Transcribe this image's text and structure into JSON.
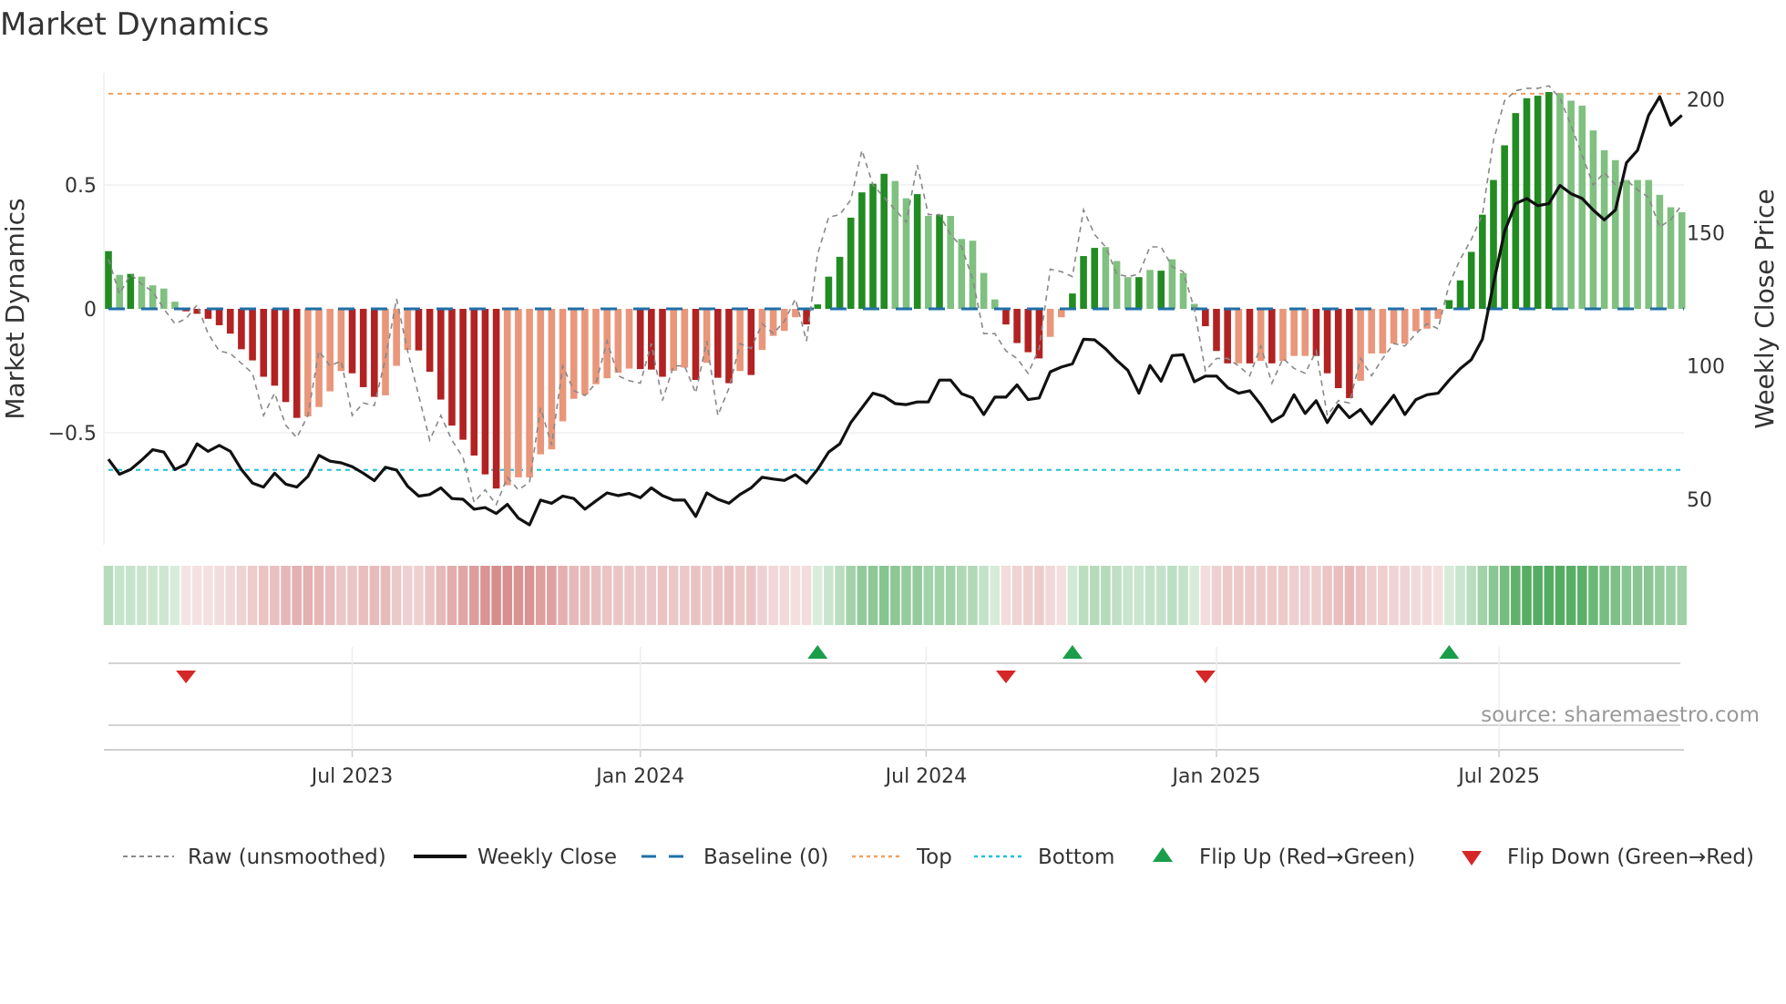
{
  "chart_data": {
    "type": "bar",
    "title": "Market Dynamics",
    "ylabel": "Market Dynamics",
    "y2label": "Weekly Close Price",
    "source": "source: sharemaestro.com",
    "ylim": [
      -0.98,
      0.96
    ],
    "y2lim": [
      35,
      210
    ],
    "yticks": [
      {
        "v": 0.5,
        "label": "0.5"
      },
      {
        "v": 0,
        "label": "0"
      },
      {
        "v": -0.5,
        "label": "−0.5"
      }
    ],
    "y2ticks": [
      {
        "v": 200,
        "label": "200"
      },
      {
        "v": 150,
        "label": "150"
      },
      {
        "v": 100,
        "label": "100"
      },
      {
        "v": 50,
        "label": "50"
      }
    ],
    "xticks": [
      {
        "i": 22,
        "label": "Jul 2023"
      },
      {
        "i": 48,
        "label": "Jan 2024"
      },
      {
        "i": 73.8,
        "label": "Jul 2024"
      },
      {
        "i": 100,
        "label": "Jan 2025"
      },
      {
        "i": 125.5,
        "label": "Jul 2025"
      }
    ],
    "top_level": 0.868,
    "bottom_level": -0.65,
    "baseline": 0,
    "colors": {
      "up_strong": "#228b22",
      "up_weak": "#80c080",
      "down_strong": "#b22222",
      "down_weak": "#e9967a",
      "close": "#111111",
      "raw": "#888888",
      "baseline": "#1f6fa8",
      "top": "#f0a060",
      "bottom": "#22c0d8",
      "flip_up": "#1a9e4a",
      "flip_down": "#d62728"
    },
    "smoothed": [
      0.233,
      0.137,
      0.141,
      0.13,
      0.095,
      0.082,
      0.029,
      -0.01,
      -0.02,
      -0.04,
      -0.066,
      -0.1,
      -0.163,
      -0.208,
      -0.274,
      -0.31,
      -0.376,
      -0.44,
      -0.434,
      -0.396,
      -0.333,
      -0.251,
      -0.26,
      -0.316,
      -0.355,
      -0.349,
      -0.23,
      -0.166,
      -0.168,
      -0.254,
      -0.366,
      -0.471,
      -0.528,
      -0.592,
      -0.668,
      -0.725,
      -0.712,
      -0.68,
      -0.68,
      -0.587,
      -0.567,
      -0.454,
      -0.363,
      -0.346,
      -0.304,
      -0.28,
      -0.258,
      -0.241,
      -0.243,
      -0.245,
      -0.274,
      -0.25,
      -0.237,
      -0.287,
      -0.218,
      -0.278,
      -0.3,
      -0.251,
      -0.267,
      -0.166,
      -0.109,
      -0.089,
      -0.034,
      -0.063,
      0.018,
      0.13,
      0.21,
      0.368,
      0.47,
      0.505,
      0.545,
      0.516,
      0.446,
      0.463,
      0.375,
      0.38,
      0.375,
      0.282,
      0.275,
      0.145,
      0.038,
      -0.063,
      -0.138,
      -0.175,
      -0.2,
      -0.113,
      -0.034,
      0.062,
      0.213,
      0.246,
      0.249,
      0.193,
      0.128,
      0.128,
      0.157,
      0.154,
      0.2,
      0.145,
      0.02,
      -0.07,
      -0.17,
      -0.22,
      -0.22,
      -0.22,
      -0.21,
      -0.22,
      -0.21,
      -0.19,
      -0.19,
      -0.19,
      -0.26,
      -0.32,
      -0.36,
      -0.29,
      -0.18,
      -0.18,
      -0.14,
      -0.14,
      -0.09,
      -0.08,
      -0.04,
      0.035,
      0.115,
      0.23,
      0.38,
      0.52,
      0.66,
      0.79,
      0.85,
      0.86,
      0.875,
      0.87,
      0.84,
      0.82,
      0.72,
      0.64,
      0.6,
      0.52,
      0.52,
      0.52,
      0.46,
      0.41,
      0.39
    ],
    "strong": [
      1,
      0,
      1,
      0,
      0,
      0,
      0,
      1,
      1,
      1,
      1,
      1,
      1,
      1,
      1,
      1,
      1,
      1,
      0,
      0,
      0,
      0,
      1,
      1,
      1,
      0,
      0,
      0,
      1,
      1,
      1,
      1,
      1,
      1,
      1,
      1,
      0,
      0,
      0,
      0,
      0,
      0,
      0,
      0,
      0,
      0,
      0,
      0,
      1,
      1,
      1,
      0,
      0,
      1,
      0,
      1,
      1,
      0,
      1,
      0,
      0,
      0,
      0,
      1,
      1,
      1,
      1,
      1,
      1,
      1,
      1,
      0,
      0,
      1,
      0,
      1,
      0,
      0,
      0,
      0,
      0,
      1,
      1,
      1,
      1,
      0,
      0,
      1,
      1,
      1,
      0,
      0,
      0,
      1,
      0,
      1,
      0,
      0,
      0,
      1,
      1,
      1,
      0,
      1,
      0,
      1,
      0,
      0,
      0,
      1,
      1,
      1,
      1,
      0,
      0,
      0,
      0,
      0,
      0,
      0,
      0,
      1,
      1,
      1,
      1,
      1,
      1,
      1,
      1,
      1,
      1,
      0,
      0,
      0,
      0,
      0,
      0,
      0,
      0,
      0,
      0,
      0,
      0
    ],
    "raw": [
      0.2,
      0.06,
      0.14,
      0.1,
      0.07,
      0.0,
      -0.06,
      -0.04,
      0.016,
      -0.1,
      -0.17,
      -0.18,
      -0.22,
      -0.26,
      -0.43,
      -0.34,
      -0.47,
      -0.52,
      -0.43,
      -0.17,
      -0.23,
      -0.21,
      -0.43,
      -0.38,
      -0.39,
      -0.2,
      0.04,
      -0.17,
      -0.35,
      -0.53,
      -0.43,
      -0.53,
      -0.6,
      -0.78,
      -0.73,
      -0.79,
      -0.68,
      -0.73,
      -0.7,
      -0.4,
      -0.55,
      -0.23,
      -0.33,
      -0.35,
      -0.3,
      -0.13,
      -0.27,
      -0.29,
      -0.3,
      -0.14,
      -0.37,
      -0.23,
      -0.23,
      -0.34,
      -0.13,
      -0.43,
      -0.32,
      -0.14,
      -0.16,
      -0.06,
      -0.1,
      -0.05,
      0.04,
      -0.13,
      0.22,
      0.37,
      0.38,
      0.44,
      0.64,
      0.5,
      0.45,
      0.4,
      0.35,
      0.58,
      0.38,
      0.38,
      0.3,
      0.25,
      0.12,
      -0.1,
      -0.1,
      -0.17,
      -0.2,
      -0.26,
      -0.16,
      0.16,
      0.15,
      0.13,
      0.4,
      0.3,
      0.25,
      0.14,
      0.13,
      0.14,
      0.25,
      0.25,
      0.17,
      0.15,
      0.0,
      -0.25,
      -0.2,
      -0.2,
      -0.23,
      -0.27,
      -0.15,
      -0.3,
      -0.2,
      -0.24,
      -0.26,
      -0.17,
      -0.43,
      -0.37,
      -0.38,
      -0.2,
      -0.27,
      -0.2,
      -0.14,
      -0.15,
      -0.1,
      -0.06,
      -0.08,
      0.1,
      0.2,
      0.28,
      0.38,
      0.68,
      0.84,
      0.88,
      0.89,
      0.89,
      0.9,
      0.85,
      0.74,
      0.62,
      0.5,
      0.55,
      0.5,
      0.52,
      0.48,
      0.45,
      0.33,
      0.36,
      0.42
    ],
    "close": [
      65,
      59.4,
      61.2,
      64.7,
      68.6,
      67.7,
      61.2,
      63.2,
      70.8,
      68,
      70.2,
      68,
      61.2,
      56.1,
      54.6,
      59.8,
      55.7,
      54.6,
      58.6,
      66.5,
      64.3,
      63.7,
      62.2,
      59.8,
      57,
      62,
      61,
      54.9,
      51.2,
      51.8,
      54.3,
      50.3,
      50,
      46.3,
      46.9,
      44.7,
      48.1,
      42.9,
      40.4,
      49.7,
      48.5,
      51.2,
      50.3,
      46.3,
      49.4,
      52.4,
      51.4,
      52.2,
      50.6,
      54.3,
      51.4,
      49.7,
      49.7,
      43.6,
      52.4,
      50,
      48.5,
      51.8,
      54.3,
      58.3,
      57.6,
      57.1,
      59.2,
      56.1,
      61.2,
      67.7,
      70.8,
      78.8,
      84.3,
      89.8,
      88.6,
      85.9,
      85.5,
      86.5,
      86.5,
      94.7,
      94.7,
      89.6,
      88,
      81.8,
      88.3,
      88.3,
      92.9,
      87.4,
      88,
      97.8,
      99.6,
      100.8,
      110,
      109.8,
      106.4,
      102.1,
      98.4,
      89.8,
      100.2,
      94.3,
      103.9,
      104.2,
      94.1,
      96.2,
      96.2,
      91.9,
      89.8,
      90.7,
      85.5,
      79.1,
      81.5,
      89.2,
      82.2,
      87,
      78.8,
      85.3,
      80.6,
      83.7,
      78.2,
      83.7,
      89,
      81.8,
      87.4,
      89.2,
      89.8,
      94.7,
      99,
      102.4,
      110,
      130.9,
      150.5,
      160.9,
      162.8,
      160.1,
      160.9,
      167.7,
      164.6,
      162.8,
      158.5,
      154.8,
      158.5,
      176.2,
      180.9,
      194,
      201,
      190.3,
      194
    ],
    "flips_up": [
      64,
      87,
      121
    ],
    "flips_down": [
      7,
      81,
      99
    ],
    "legend": {
      "raw": "Raw (unsmoothed)",
      "close": "Weekly Close",
      "baseline": "Baseline (0)",
      "top": "Top",
      "bottom": "Bottom",
      "flip_up": "Flip Up (Red→Green)",
      "flip_down": "Flip Down (Green→Red)"
    },
    "legend_placement": "bottom"
  }
}
